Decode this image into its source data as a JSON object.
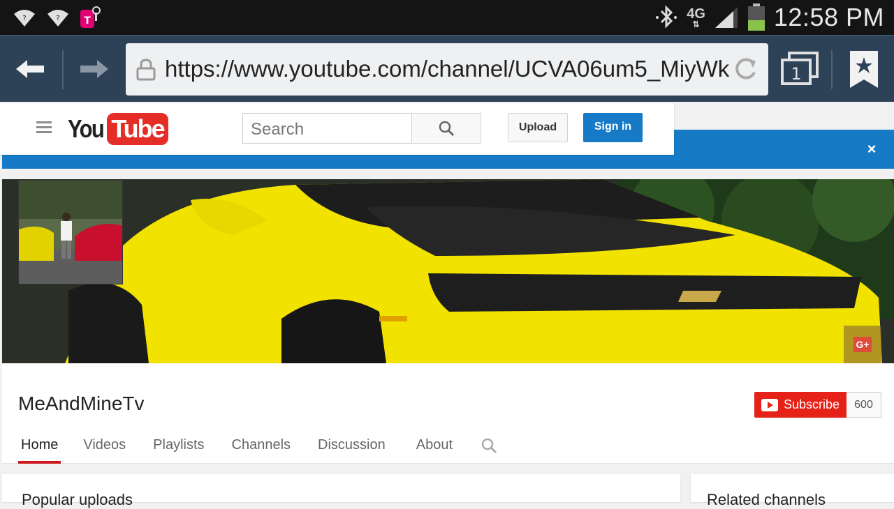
{
  "status_bar": {
    "time": "12:58 PM",
    "network": "4G",
    "icons": [
      "wifi-icon",
      "wifi-icon",
      "tmobile-app-icon",
      "bluetooth-icon",
      "signal-icon",
      "battery-icon"
    ]
  },
  "browser": {
    "url": "https://www.youtube.com/channel/UCVA06um5_MiyWk",
    "tab_count": "1",
    "icons": [
      "back-arrow-icon",
      "forward-arrow-icon",
      "lock-icon",
      "reload-icon",
      "tabs-icon",
      "bookmark-icon"
    ]
  },
  "youtube_header": {
    "logo_you": "You",
    "logo_tube": "Tube",
    "search_placeholder": "Search",
    "upload_label": "Upload",
    "signin_label": "Sign in"
  },
  "notice": {
    "close_label": "×"
  },
  "channel": {
    "name": "MeAndMineTv",
    "subscribe_label": "Subscribe",
    "subscriber_count": "600",
    "gplus_label": "G+",
    "tabs": [
      "Home",
      "Videos",
      "Playlists",
      "Channels",
      "Discussion",
      "About"
    ],
    "active_tab": "Home"
  },
  "sections": {
    "popular_uploads": "Popular uploads",
    "related_channels": "Related channels"
  },
  "colors": {
    "status_bar": "#141414",
    "browser_bar": "#2d4256",
    "youtube_red": "#e62117",
    "youtube_blue": "#167ac6",
    "banner_yellow": "#f5e600"
  }
}
